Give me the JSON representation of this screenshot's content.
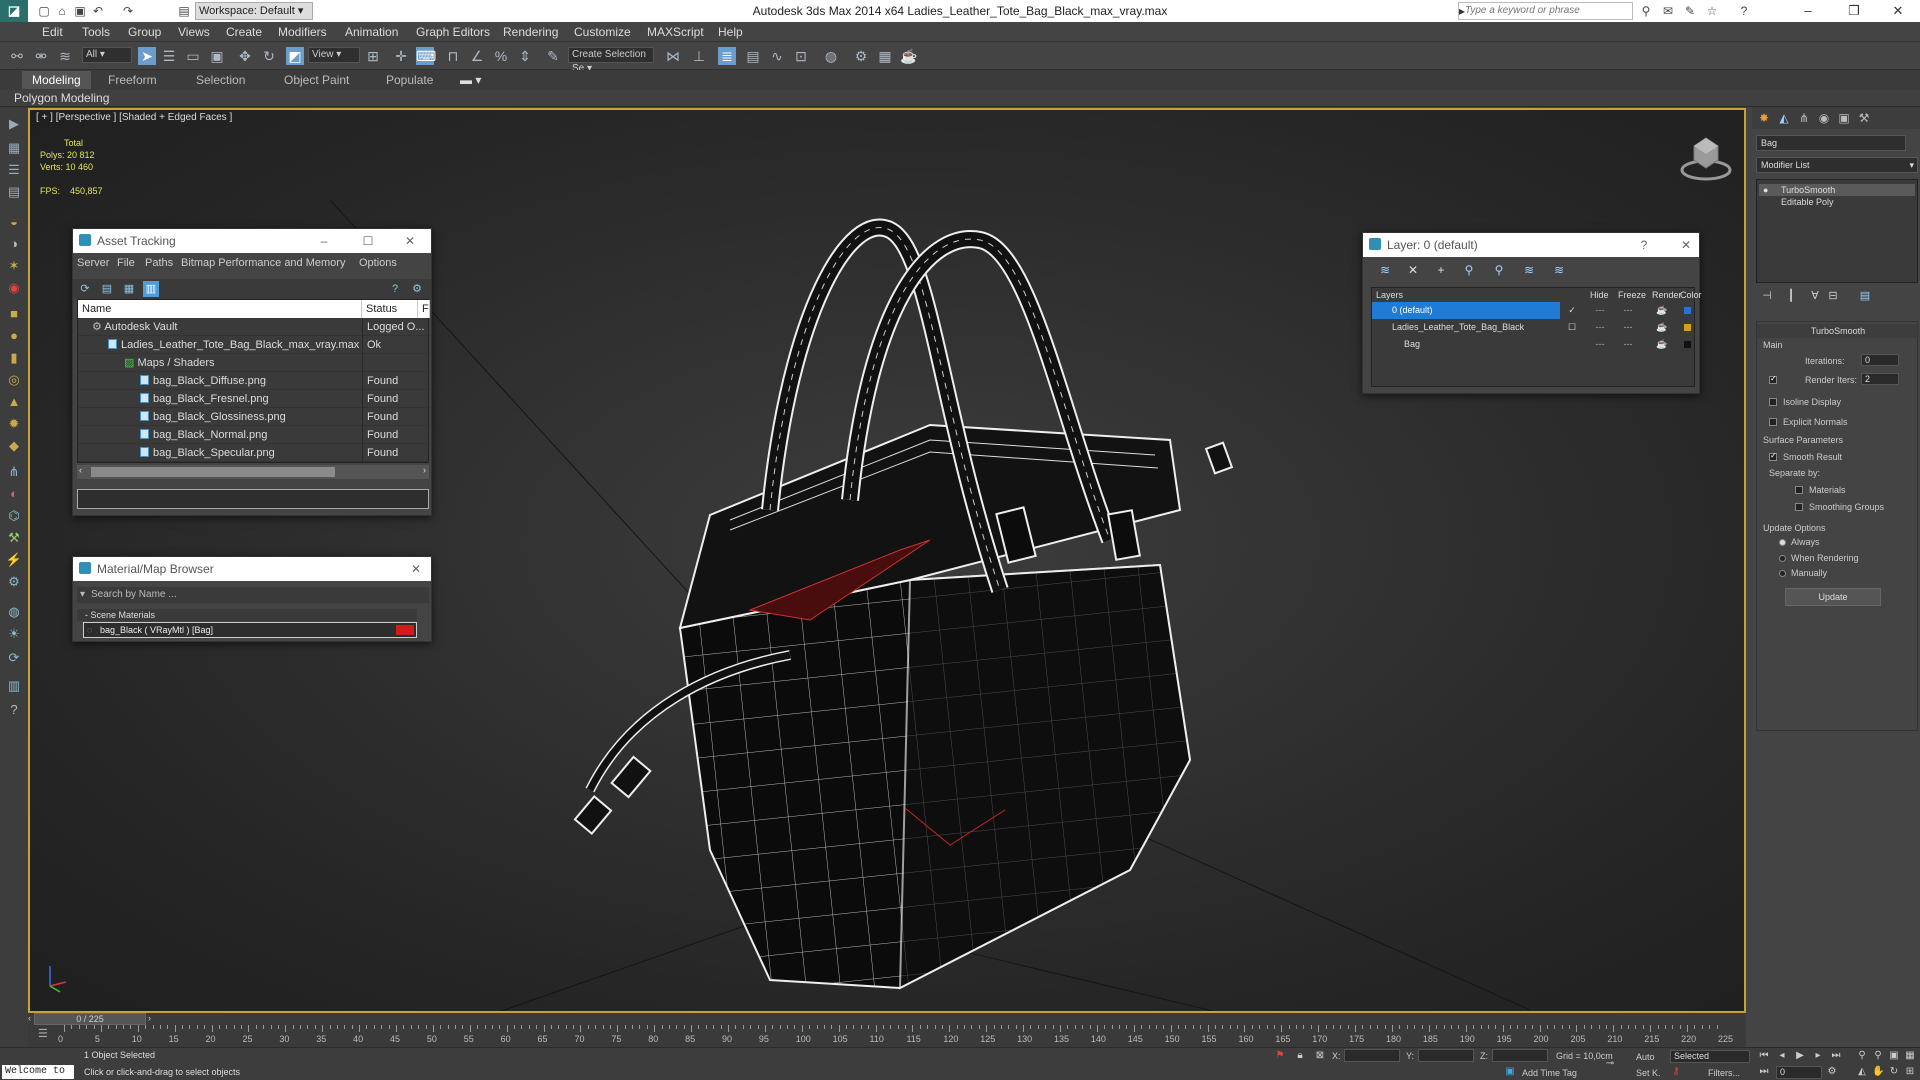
{
  "titlebar": {
    "app_icon": "max-logo",
    "workspace": "Workspace: Default",
    "title": "Autodesk 3ds Max  2014 x64     Ladies_Leather_Tote_Bag_Black_max_vray.max",
    "search_placeholder": "Type a keyword or phrase"
  },
  "menu": [
    "Edit",
    "Tools",
    "Group",
    "Views",
    "Create",
    "Modifiers",
    "Animation",
    "Graph Editors",
    "Rendering",
    "Customize",
    "MAXScript",
    "Help"
  ],
  "toolbar": {
    "selection_filter": "All",
    "ref_coord": "View",
    "named_selection": "Create Selection Se"
  },
  "ribbon": {
    "tabs": [
      "Modeling",
      "Freeform",
      "Selection",
      "Object Paint",
      "Populate"
    ],
    "active_tab": "Modeling",
    "sub_label": "Polygon Modeling"
  },
  "viewport": {
    "label": "[ + ] [Perspective ] [Shaded + Edged Faces ]",
    "total_label": "Total",
    "polys_label": "Polys:",
    "polys_value": "20 812",
    "verts_label": "Verts:",
    "verts_value": "10 460",
    "fps_label": "FPS:",
    "fps_value": "450,857"
  },
  "asset_tracking": {
    "title": "Asset Tracking",
    "menu": [
      "Server",
      "File",
      "Paths",
      "Bitmap Performance and Memory",
      "Options"
    ],
    "col_name": "Name",
    "col_status": "Status",
    "col_extra": "F",
    "rows": [
      {
        "name": "Autodesk Vault",
        "status": "Logged O..."
      },
      {
        "name": "Ladies_Leather_Tote_Bag_Black_max_vray.max",
        "status": "Ok"
      },
      {
        "name": "Maps / Shaders",
        "status": ""
      },
      {
        "name": "bag_Black_Diffuse.png",
        "status": "Found"
      },
      {
        "name": "bag_Black_Fresnel.png",
        "status": "Found"
      },
      {
        "name": "bag_Black_Glossiness.png",
        "status": "Found"
      },
      {
        "name": "bag_Black_Normal.png",
        "status": "Found"
      },
      {
        "name": "bag_Black_Specular.png",
        "status": "Found"
      }
    ]
  },
  "material_browser": {
    "title": "Material/Map Browser",
    "search_placeholder": "Search by Name ...",
    "group": "- Scene Materials",
    "item": "bag_Black  ( VRayMtl )  [Bag]",
    "item_color": "#d41b1b"
  },
  "layer_dialog": {
    "title": "Layer: 0 (default)",
    "help": "?",
    "col_layers": "Layers",
    "col_hide": "Hide",
    "col_freeze": "Freeze",
    "col_render": "Render",
    "col_color": "Color",
    "rows": [
      {
        "name": "0 (default)",
        "color": "#2a6fe0"
      },
      {
        "name": "Ladies_Leather_Tote_Bag_Black",
        "color": "#d1a020"
      },
      {
        "name": "Bag",
        "color": "#111111"
      }
    ]
  },
  "command_panel": {
    "object_name": "Bag",
    "modifier_list": "Modifier List",
    "stack": [
      "TurboSmooth",
      "Editable Poly"
    ],
    "rollout_title": "TurboSmooth",
    "main_label": "Main",
    "iterations_label": "Iterations:",
    "iterations_value": "0",
    "render_iters_label": "Render Iters:",
    "render_iters_value": "2",
    "isoline": "Isoline Display",
    "explicit_normals": "Explicit Normals",
    "surface_params": "Surface Parameters",
    "smooth_result": "Smooth Result",
    "separate_by": "Separate by:",
    "materials": "Materials",
    "smoothing_groups": "Smoothing Groups",
    "update_options": "Update Options",
    "always": "Always",
    "when_rendering": "When Rendering",
    "manually": "Manually",
    "update_button": "Update"
  },
  "timeline": {
    "slider": "0 / 225",
    "ticks": [
      "0",
      "5",
      "10",
      "15",
      "20",
      "25",
      "30",
      "35",
      "40",
      "45",
      "50",
      "55",
      "60",
      "65",
      "70",
      "75",
      "80",
      "85",
      "90",
      "95",
      "100",
      "105",
      "110",
      "115",
      "120",
      "125",
      "130",
      "135",
      "140",
      "145",
      "150",
      "155",
      "160",
      "165",
      "170",
      "175",
      "180",
      "185",
      "190",
      "195",
      "200",
      "205",
      "210",
      "215",
      "220",
      "225"
    ]
  },
  "status": {
    "welcome": "Welcome to",
    "selected": "1 Object Selected",
    "prompt": "Click or click-and-drag to select objects",
    "x_label": "X:",
    "y_label": "Y:",
    "z_label": "Z:",
    "grid": "Grid = 10,0cm",
    "auto": "Auto",
    "key_mode": "Selected",
    "set_key": "Set K.",
    "filters": "Filters...",
    "add_time_tag": "Add Time Tag",
    "frame": "0"
  }
}
